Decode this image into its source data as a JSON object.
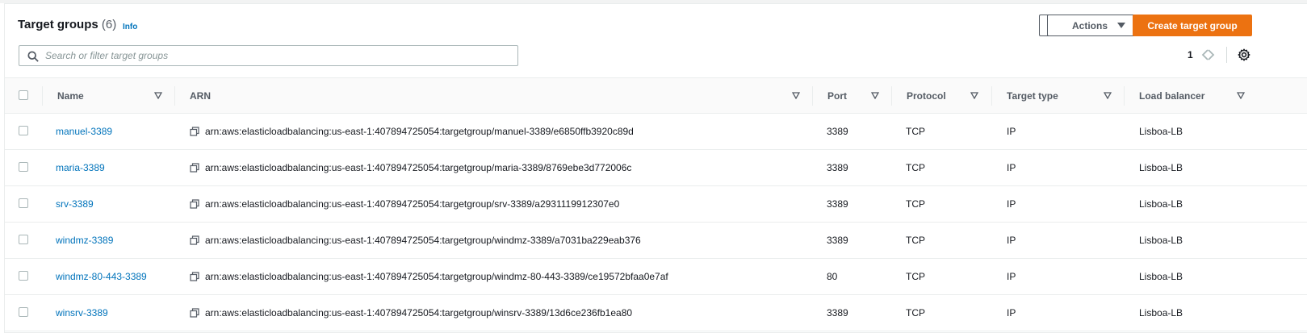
{
  "header": {
    "title": "Target groups",
    "count": "(6)",
    "info_label": "Info",
    "actions_label": "Actions",
    "create_label": "Create target group"
  },
  "search": {
    "placeholder": "Search or filter target groups",
    "value": ""
  },
  "pagination": {
    "current_page": "1"
  },
  "table": {
    "columns": [
      "Name",
      "ARN",
      "Port",
      "Protocol",
      "Target type",
      "Load balancer"
    ],
    "rows": [
      {
        "name": "manuel-3389",
        "arn": "arn:aws:elasticloadbalancing:us-east-1:407894725054:targetgroup/manuel-3389/e6850ffb3920c89d",
        "port": "3389",
        "protocol": "TCP",
        "target_type": "IP",
        "load_balancer": "Lisboa-LB"
      },
      {
        "name": "maria-3389",
        "arn": "arn:aws:elasticloadbalancing:us-east-1:407894725054:targetgroup/maria-3389/8769ebe3d772006c",
        "port": "3389",
        "protocol": "TCP",
        "target_type": "IP",
        "load_balancer": "Lisboa-LB"
      },
      {
        "name": "srv-3389",
        "arn": "arn:aws:elasticloadbalancing:us-east-1:407894725054:targetgroup/srv-3389/a2931119912307e0",
        "port": "3389",
        "protocol": "TCP",
        "target_type": "IP",
        "load_balancer": "Lisboa-LB"
      },
      {
        "name": "windmz-3389",
        "arn": "arn:aws:elasticloadbalancing:us-east-1:407894725054:targetgroup/windmz-3389/a7031ba229eab376",
        "port": "3389",
        "protocol": "TCP",
        "target_type": "IP",
        "load_balancer": "Lisboa-LB"
      },
      {
        "name": "windmz-80-443-3389",
        "arn": "arn:aws:elasticloadbalancing:us-east-1:407894725054:targetgroup/windmz-80-443-3389/ce19572bfaa0e7af",
        "port": "80",
        "protocol": "TCP",
        "target_type": "IP",
        "load_balancer": "Lisboa-LB"
      },
      {
        "name": "winsrv-3389",
        "arn": "arn:aws:elasticloadbalancing:us-east-1:407894725054:targetgroup/winsrv-3389/13d6ce236fb1ea80",
        "port": "3389",
        "protocol": "TCP",
        "target_type": "IP",
        "load_balancer": "Lisboa-LB"
      }
    ]
  },
  "icons": {
    "search": "search-icon",
    "refresh": "refresh-icon",
    "caret": "caret-down-icon",
    "prev": "chevron-left-icon",
    "next": "chevron-right-icon",
    "settings": "gear-icon",
    "copy": "copy-icon",
    "sort": "sort-icon"
  },
  "colors": {
    "accent": "#ec7211",
    "link": "#0073bb",
    "text": "#16191f",
    "muted": "#545b64",
    "border": "#eaeded"
  }
}
